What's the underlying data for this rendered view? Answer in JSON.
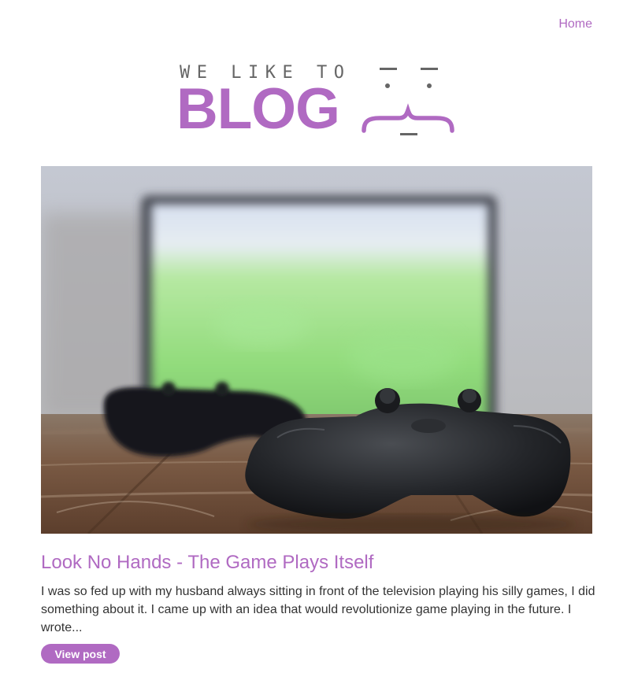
{
  "nav": {
    "home_label": "Home"
  },
  "logo": {
    "tagline": "WE LIKE TO",
    "word": "BLOG"
  },
  "post": {
    "title": "Look No Hands - The Game Plays Itself",
    "excerpt": "I was so fed up with my husband always sitting in front of the television playing his silly games, I did something about it. I came up with an idea that would revolutionize game playing in the future. I wrote...",
    "button_label": "View post",
    "image_subject": "game-controllers-on-table-photo"
  },
  "colors": {
    "accent": "#b06ac2",
    "text": "#333333",
    "logo_gray": "#666666",
    "background": "#ffffff"
  }
}
